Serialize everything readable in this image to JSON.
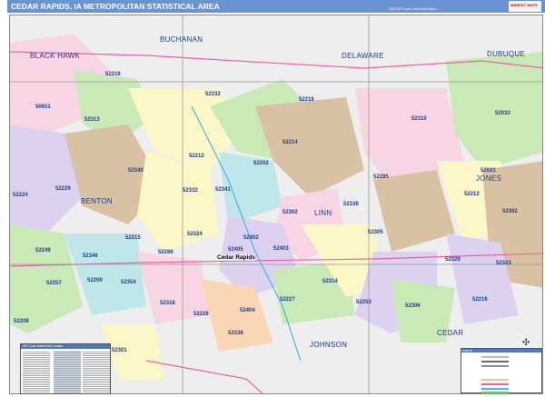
{
  "header": {
    "title": "CEDAR RAPIDS, IA METROPOLITAN STATISTICAL AREA",
    "subtitle": "2020 ZIP Code Color/Cast Edition",
    "logo": "MARKET MAPS"
  },
  "counties": [
    "BUCHANAN",
    "BLACK HAWK",
    "DELAWARE",
    "DUBUQUE",
    "BENTON",
    "LINN",
    "JONES",
    "JOHNSON",
    "CEDAR"
  ],
  "city": "Cedar Rapids",
  "zips": [
    "52218",
    "50651",
    "52313",
    "52332",
    "52218",
    "52310",
    "52033",
    "52214",
    "52212",
    "52202",
    "52340",
    "52341",
    "52229",
    "52224",
    "52332",
    "52285",
    "52021",
    "52212",
    "52338",
    "52302",
    "52362",
    "52324",
    "52315",
    "52305",
    "52249",
    "52346",
    "52286",
    "52403",
    "52402",
    "52405",
    "52329",
    "52323",
    "52257",
    "52209",
    "52354",
    "52314",
    "52318",
    "52227",
    "52253",
    "52306",
    "52216",
    "52208",
    "52228",
    "52404",
    "52338",
    "52301"
  ],
  "index": {
    "title": "ZIP Code Index/Grid Locator"
  },
  "legend": {
    "title": "Legend"
  },
  "colors": {
    "header": "#6a93d4",
    "highway": "#ee5fa7",
    "water": "#44b7e6"
  }
}
